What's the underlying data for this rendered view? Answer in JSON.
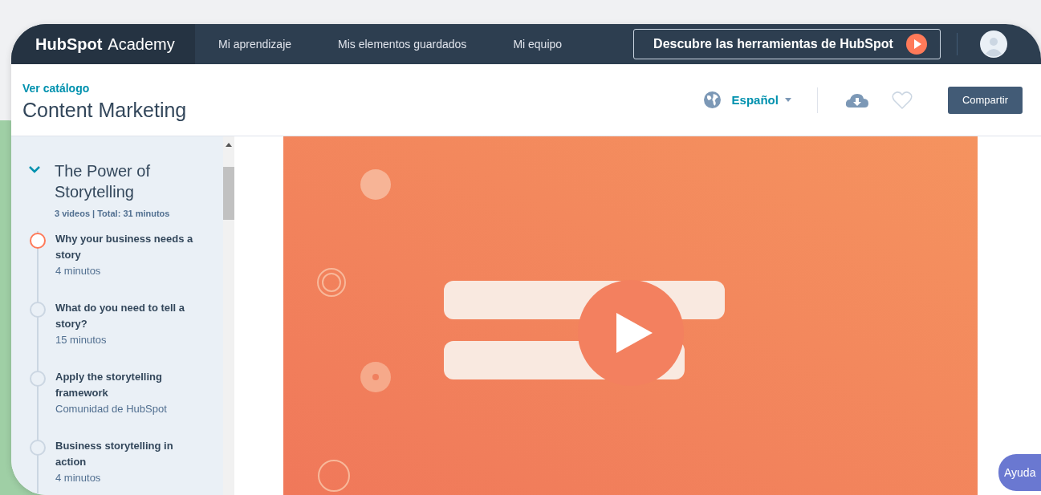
{
  "nav": {
    "logo": "HubSpot",
    "logo_suffix": "Academy",
    "links": [
      {
        "label": "Mi aprendizaje",
        "selected": false
      },
      {
        "label": "Mis elementos guardados",
        "selected": false
      },
      {
        "label": "Mi equipo",
        "selected": false
      }
    ],
    "promo_button": "Descubre las herramientas de HubSpot"
  },
  "header": {
    "breadcrumb": "Ver catálogo",
    "title": "Content Marketing",
    "language": "Español",
    "share_button": "Compartir"
  },
  "sidebar": {
    "section": {
      "title": "The Power of Storytelling",
      "expanded": true,
      "summary": "3 videos | Total: 31 minutos",
      "lessons": [
        {
          "title": "Why your business needs a story",
          "meta": "4 minutos",
          "selected": true
        },
        {
          "title": "What do you need to tell a story?",
          "meta": "15 minutos",
          "selected": false
        },
        {
          "title": "Apply the storytelling framework",
          "meta": "Comunidad de HubSpot",
          "selected": false
        },
        {
          "title": "Business storytelling in action",
          "meta": "4 minutos",
          "selected": false
        }
      ]
    }
  },
  "help_button": "Ayuda"
}
